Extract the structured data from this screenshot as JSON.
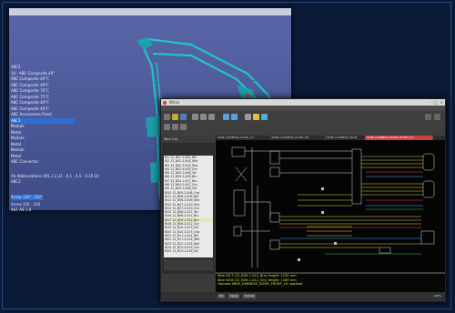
{
  "cad": {
    "tree": [
      "ABC1",
      "10 : ABC Composite 40°",
      "ABC Composite 40°C",
      "ABC Composite 40°C",
      "ABC Composite 70°C",
      "ABC Composite 75°C",
      "ABC Composite 40°C",
      "ABC Composite 40°C",
      "ABC Accessories Fixed",
      "ABC1",
      "Module",
      "Metal",
      "Module",
      "Metal",
      "Module",
      "Metal",
      "ABC Connector"
    ],
    "tree_selected_index": 9,
    "status": [
      "Ab Abbreviations 001.2.2.21 : 4.1 : 4.5 : 4.10.10",
      "ABC2",
      "Arrow 120°, 120°",
      "Arrow 120 : 120",
      "Ab1 AB 1.8"
    ]
  },
  "harness": {
    "title": "Wires",
    "menu": [
      "File",
      "Edit",
      "View",
      "Insert",
      "Tools",
      "Window",
      "Help"
    ],
    "tabs": [
      "WIRE_HARNESS_DOOR_LH",
      "WIRE_HARNESS_DOOR_RH",
      "WIRE_HARNESS_MAIN",
      "WIRE_HARNESS_DOOR_FRONT_LH"
    ],
    "active_tab": 3,
    "sidebar_title": "Wire List",
    "rows": [
      "W1  12_B01-1-X04_Blk",
      "W2  12_B01-2-X04_Wht",
      "W3  12_B02-3-X05_Red",
      "W4  12_B02-4-X05_Grn",
      "W5  12_B03-1-X06_Yel",
      "W6  12_B03-2-X06_Blu",
      "W7  12_B04-1-X07_Brn",
      "W8  12_B04-2-X07_Gry",
      "W9  12_B05-1-X08_Vio",
      "W10 12_B05-2-X08_Org",
      "W11 12_B06-1-X09_Blk",
      "W12 12_B06-2-X09_Wht",
      "W13 12_B07-1-X10_Red",
      "W14 12_B07-2-X10_Grn",
      "W15 12_B08-1-X11_Yel",
      "W16 12_B08-2-X11_Blu",
      "W17 12_B09-1-X12_Brn",
      "W18 12_B09-2-X12_Gry",
      "W19 12_B10-1-X13_Vio",
      "W20 12_B10-2-X13_Org",
      "W21 12_B11-1-X14_Blk",
      "W22 12_B11-2-X14_Wht",
      "W23 12_B12-1-X15_Red",
      "W24 12_B12-2-X15_Grn",
      "W25 12_B13-1-X16_Yel"
    ],
    "row_selected_index": 16,
    "console": [
      "Wire W17 (12_B09-1-X12_Brn) length: 1230 mm",
      "Wire W18 (12_B09-2-X12_Gry) length: 1185 mm",
      "Harness WIRE_HARNESS_DOOR_FRONT_LH updated"
    ],
    "status_buttons": [
      "OK",
      "Apply",
      "Cancel"
    ],
    "zoom": "100%"
  }
}
